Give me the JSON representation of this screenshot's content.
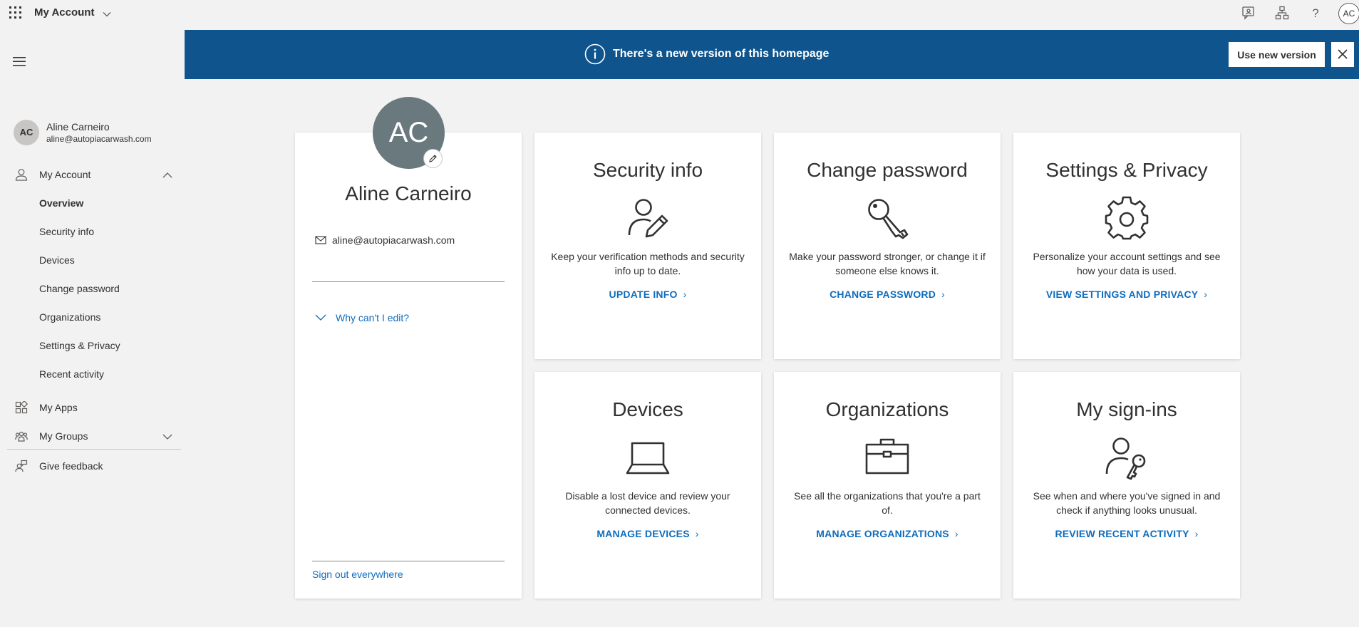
{
  "topbar": {
    "app_title": "My Account",
    "avatar_initials": "AC",
    "icons": [
      "waffle-icon",
      "feedback-icon",
      "org-chart-icon",
      "help-icon"
    ]
  },
  "banner": {
    "text": "There's a new version of this homepage",
    "button_label": "Use new version",
    "bg_color": "#0f548c"
  },
  "sidebar": {
    "user": {
      "initials": "AC",
      "name": "Aline Carneiro",
      "email": "aline@autopiacarwash.com"
    },
    "my_account_label": "My Account",
    "sub_items": [
      {
        "label": "Overview",
        "active": true
      },
      {
        "label": "Security info"
      },
      {
        "label": "Devices"
      },
      {
        "label": "Change password"
      },
      {
        "label": "Organizations"
      },
      {
        "label": "Settings & Privacy"
      },
      {
        "label": "Recent activity"
      }
    ],
    "my_apps_label": "My Apps",
    "my_groups_label": "My Groups",
    "feedback_label": "Give feedback"
  },
  "profile": {
    "initials": "AC",
    "name": "Aline Carneiro",
    "email": "aline@autopiacarwash.com",
    "why_link": "Why can't I edit?",
    "sign_out": "Sign out everywhere"
  },
  "tiles": [
    {
      "title": "Security info",
      "icon": "user-edit-icon",
      "desc": "Keep your verification methods and security info up to date.",
      "link": "UPDATE INFO"
    },
    {
      "title": "Change password",
      "icon": "key-icon",
      "desc": "Make your password stronger, or change it if someone else knows it.",
      "link": "CHANGE PASSWORD"
    },
    {
      "title": "Settings & Privacy",
      "icon": "gear-icon",
      "desc": "Personalize your account settings and see how your data is used.",
      "link": "VIEW SETTINGS AND PRIVACY"
    },
    {
      "title": "Devices",
      "icon": "laptop-icon",
      "desc": "Disable a lost device and review your connected devices.",
      "link": "MANAGE DEVICES"
    },
    {
      "title": "Organizations",
      "icon": "briefcase-icon",
      "desc": "See all the organizations that you're a part of.",
      "link": "MANAGE ORGANIZATIONS"
    },
    {
      "title": "My sign-ins",
      "icon": "user-key-icon",
      "desc": "See when and where you've signed in and check if anything looks unusual.",
      "link": "REVIEW RECENT ACTIVITY"
    }
  ],
  "colors": {
    "accent": "#0f6cbd",
    "page_bg": "#f2f2f2",
    "avatar_bg": "#69797e"
  }
}
